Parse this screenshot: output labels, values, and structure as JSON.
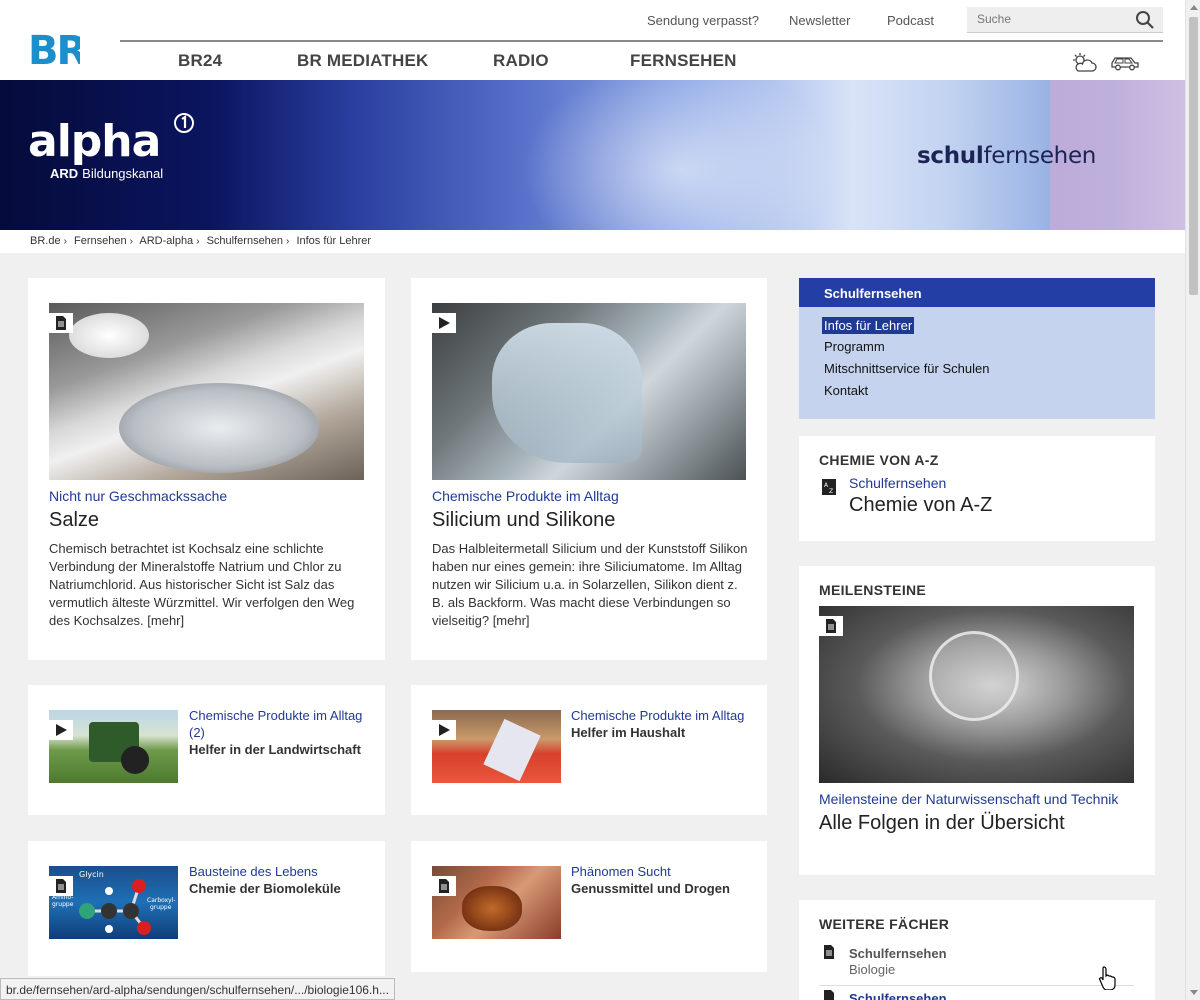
{
  "header": {
    "top_links": [
      "Sendung verpasst?",
      "Newsletter",
      "Podcast"
    ],
    "search_placeholder": "Suche",
    "nav": [
      "BR24",
      "BR MEDIATHEK",
      "RADIO",
      "FERNSEHEN"
    ],
    "logo_text": "BR"
  },
  "banner": {
    "alpha_word": "alpha",
    "alpha_ard": "ARD",
    "alpha_sub": "Bildungskanal",
    "schul_bold": "schul",
    "schul_rest": "fernsehen"
  },
  "breadcrumb": [
    "BR.de",
    "Fernsehen",
    "ARD-alpha",
    "Schulfernsehen",
    "Infos für Lehrer"
  ],
  "cards_large": [
    {
      "kicker": "Nicht nur Geschmackssache",
      "title": "Salze",
      "description": "Chemisch betrachtet ist Kochsalz eine schlichte Verbindung der Mineralstoffe Natrium und Chlor zu Natriumchlorid. Aus historischer Sicht ist Salz das vermutlich älteste Würzmittel. Wir verfolgen den Weg des Kochsalzes. [mehr]",
      "badge": "document-icon"
    },
    {
      "kicker": "Chemische Produkte im Alltag",
      "title": "Silicium und Silikone",
      "description": "Das Halbleitermetall Silicium und der Kunststoff Silikon haben nur eines gemein: ihre Siliciumatome. Im Alltag nutzen wir Silicium u.a. in Solarzellen, Silikon dient z. B. als Backform. Was macht diese Verbindungen so vielseitig? [mehr]",
      "badge": "play-icon"
    }
  ],
  "cards_small": [
    {
      "kicker": "Chemische Produkte im Alltag (2)",
      "title": "Helfer in der Landwirtschaft",
      "badge": "play-icon"
    },
    {
      "kicker": "Chemische Produkte im Alltag",
      "title": "Helfer im Haushalt",
      "badge": "play-icon"
    },
    {
      "kicker": "Bausteine des Lebens",
      "title": "Chemie der Biomoleküle",
      "badge": "document-icon"
    },
    {
      "kicker": "Phänomen Sucht",
      "title": "Genussmittel und Drogen",
      "badge": "document-icon"
    }
  ],
  "molecule_labels": {
    "glycin": "Glycin",
    "amino": "Amino-",
    "amino2": "gruppe",
    "carboxyl": "Carboxyl-",
    "carboxyl2": "gruppe"
  },
  "sidebar": {
    "menu_title": "Schulfernsehen",
    "menu_items": [
      "Infos für Lehrer",
      "Programm",
      "Mitschnittservice für Schulen",
      "Kontakt"
    ],
    "chemie": {
      "heading": "CHEMIE VON A-Z",
      "kicker": "Schulfernsehen",
      "title": "Chemie von A-Z"
    },
    "meilensteine": {
      "heading": "MEILENSTEINE",
      "kicker": "Meilensteine der Naturwissenschaft und Technik",
      "title": "Alle Folgen in der Übersicht"
    },
    "weitere": {
      "heading": "WEITERE FÄCHER",
      "items": [
        {
          "kicker": "Schulfernsehen",
          "sub": "Biologie"
        },
        {
          "kicker": "Schulfernsehen",
          "sub": ""
        }
      ]
    }
  },
  "status_url": "br.de/fernsehen/ard-alpha/sendungen/schulfernsehen/.../biologie106.h...",
  "colors": {
    "accent": "#1f3a93",
    "menu_bg": "#c5d3ef",
    "menu_head": "#233fa6",
    "br_blue": "#1c8ecb"
  }
}
